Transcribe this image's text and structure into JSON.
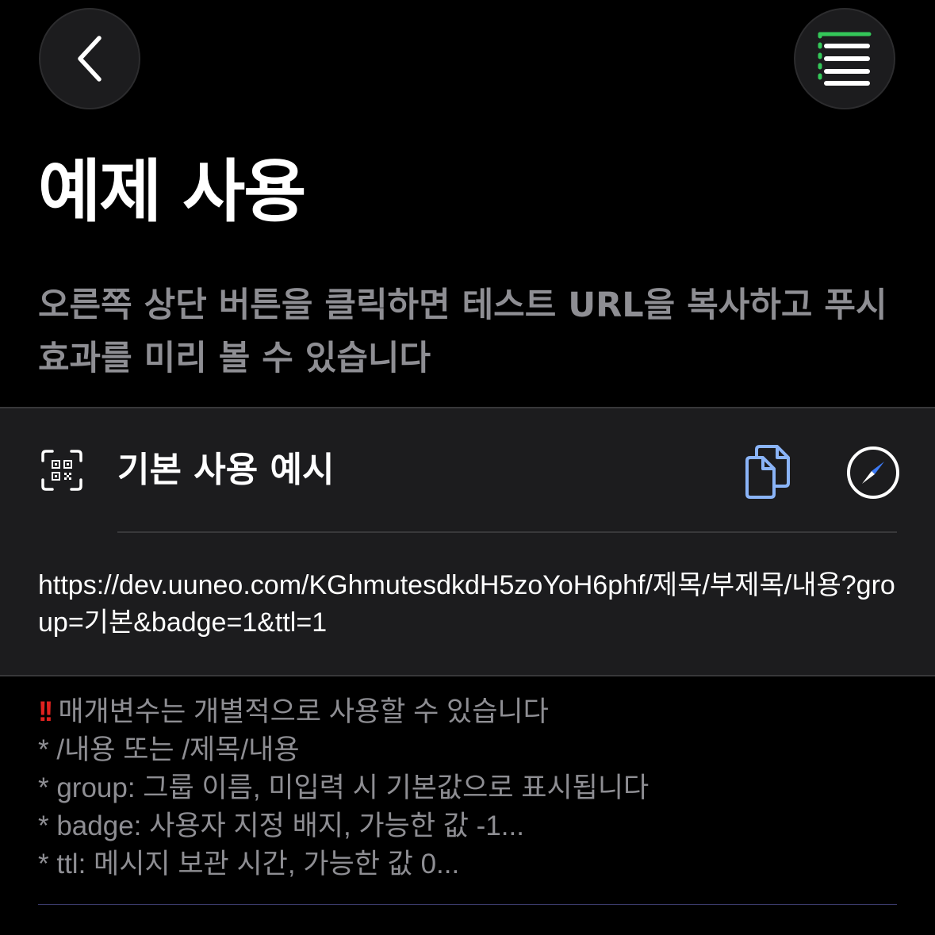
{
  "header": {
    "back_icon": "chevron-left-icon",
    "menu_icon": "list-menu-icon",
    "menu_accent_color": "#34c759"
  },
  "page": {
    "title": "예제 사용",
    "subtitle": "오른쪽 상단 버튼을 클릭하면 테스트 URL을 복사하고 푸시 효과를 미리 볼 수 있습니다"
  },
  "card": {
    "icon": "qr-code-icon",
    "title": "기본 사용 예시",
    "copy_icon": "copy-doc-icon",
    "copy_icon_color": "#8ab4f8",
    "open_icon": "safari-compass-icon",
    "url": "https://dev.uuneo.com/KGhmutesdkdH5zoYoH6phf/제목/부제목/내용?group=기본&badge=1&ttl=1"
  },
  "notes": {
    "warning_icon": "!!",
    "warning_color": "#e0221f",
    "headline": "매개변수는 개별적으로 사용할 수 있습니다",
    "items": [
      "* /내용 또는 /제목/내용",
      "* group: 그룹 이름, 미입력 시 기본값으로 표시됩니다",
      "* badge: 사용자 지정 배지, 가능한 값 -1...",
      "* ttl: 메시지 보관 시간, 가능한 값 0..."
    ]
  }
}
